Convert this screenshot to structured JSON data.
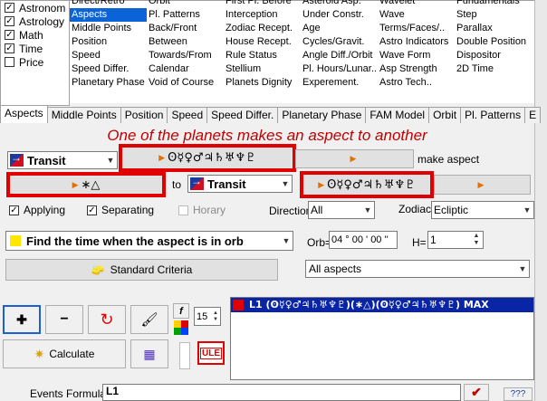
{
  "categories": [
    {
      "label": "Astronom",
      "checked": true
    },
    {
      "label": "Astrology",
      "checked": true
    },
    {
      "label": "Math",
      "checked": true
    },
    {
      "label": "Time",
      "checked": true
    },
    {
      "label": "Price",
      "checked": false
    }
  ],
  "grid_columns": [
    [
      "Direct/Retro",
      "Aspects",
      "Middle Points",
      "Position",
      "Speed",
      "Speed Differ.",
      "Planetary Phase"
    ],
    [
      "Orbit",
      "Pl. Patterns",
      "Back/Front",
      "Between",
      "Towards/From",
      "Calendar",
      "Void of Course"
    ],
    [
      "First Pl. Before",
      "Interception",
      "Zodiac Recept.",
      "House Recept.",
      "Rule Status",
      "Stellium",
      "Planets Dignity"
    ],
    [
      "Asteroid Asp.",
      "Under Constr.",
      "Age",
      "Cycles/Gravit.",
      "Angle Diff./Orbit",
      "Pl. Hours/Lunar..",
      "Experement."
    ],
    [
      "Wavelet",
      "Wave",
      "Terms/Faces/..",
      "Astro Indicators",
      "Wave Form",
      "Asp Strength",
      "Astro Tech.."
    ],
    [
      "Fundamentals",
      "Step",
      "Parallax",
      "Double Position",
      "Dispositor",
      "2D Time",
      ""
    ]
  ],
  "tabs": [
    "Aspects",
    "Middle Points",
    "Position",
    "Speed",
    "Speed Differ.",
    "Planetary Phase",
    "FAM Model",
    "Orbit",
    "Pl. Patterns",
    "E"
  ],
  "hint": "One of the planets makes an aspect to another",
  "row1": {
    "source": "Transit",
    "planets": "ʘ☿♀♂♃♄♅♆♇",
    "make_aspect": "make aspect"
  },
  "row2": {
    "aspects": "∗△",
    "to": "to",
    "target": "Transit",
    "planets": "ʘ☿♀♂♃♄♅♆♇"
  },
  "row3": {
    "applying": "Applying",
    "separating": "Separating",
    "horary": "Horary",
    "direction_label": "Direction",
    "direction_value": "All",
    "zodiac_label": "Zodiac",
    "zodiac_value": "Ecliptic"
  },
  "row4": {
    "find": "Find the time when the aspect is in orb",
    "orb_label": "Orb=",
    "orb_value": "04 ° 00 ' 00 ''",
    "h_label": "H=",
    "h_value": "1"
  },
  "row5": {
    "standard": "Standard Criteria",
    "all_aspects": "All aspects"
  },
  "tools": {
    "f_label": "f",
    "spin_value": "15",
    "calculate": "Calculate",
    "ule": "ULE"
  },
  "result": {
    "line": "L1  (ʘ☿♀♂♃♄♅♆♇)(∗△)(ʘ☿♀♂♃♄♅♆♇)  MAX"
  },
  "events": {
    "label": "Events Formula",
    "value": "L1",
    "help": "???"
  },
  "colors": {
    "highlight": "#e00000",
    "selection": "#0a64d8",
    "result_bg": "#0a24a6"
  }
}
